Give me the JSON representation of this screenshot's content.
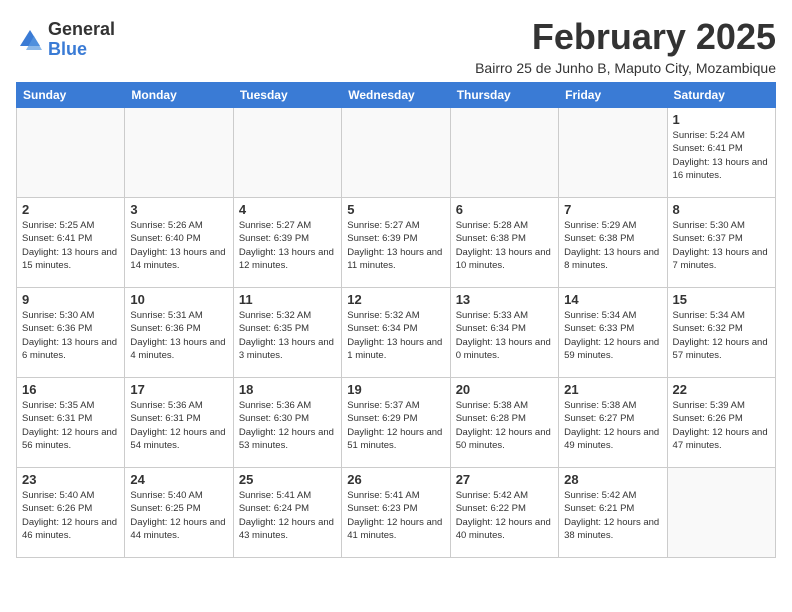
{
  "logo": {
    "general": "General",
    "blue": "Blue"
  },
  "header": {
    "month": "February 2025",
    "location": "Bairro 25 de Junho B, Maputo City, Mozambique"
  },
  "weekdays": [
    "Sunday",
    "Monday",
    "Tuesday",
    "Wednesday",
    "Thursday",
    "Friday",
    "Saturday"
  ],
  "days": {
    "day1": {
      "num": "1",
      "sunrise": "5:24 AM",
      "sunset": "6:41 PM",
      "daylight": "13 hours and 16 minutes."
    },
    "day2": {
      "num": "2",
      "sunrise": "5:25 AM",
      "sunset": "6:41 PM",
      "daylight": "13 hours and 15 minutes."
    },
    "day3": {
      "num": "3",
      "sunrise": "5:26 AM",
      "sunset": "6:40 PM",
      "daylight": "13 hours and 14 minutes."
    },
    "day4": {
      "num": "4",
      "sunrise": "5:27 AM",
      "sunset": "6:39 PM",
      "daylight": "13 hours and 12 minutes."
    },
    "day5": {
      "num": "5",
      "sunrise": "5:27 AM",
      "sunset": "6:39 PM",
      "daylight": "13 hours and 11 minutes."
    },
    "day6": {
      "num": "6",
      "sunrise": "5:28 AM",
      "sunset": "6:38 PM",
      "daylight": "13 hours and 10 minutes."
    },
    "day7": {
      "num": "7",
      "sunrise": "5:29 AM",
      "sunset": "6:38 PM",
      "daylight": "13 hours and 8 minutes."
    },
    "day8": {
      "num": "8",
      "sunrise": "5:30 AM",
      "sunset": "6:37 PM",
      "daylight": "13 hours and 7 minutes."
    },
    "day9": {
      "num": "9",
      "sunrise": "5:30 AM",
      "sunset": "6:36 PM",
      "daylight": "13 hours and 6 minutes."
    },
    "day10": {
      "num": "10",
      "sunrise": "5:31 AM",
      "sunset": "6:36 PM",
      "daylight": "13 hours and 4 minutes."
    },
    "day11": {
      "num": "11",
      "sunrise": "5:32 AM",
      "sunset": "6:35 PM",
      "daylight": "13 hours and 3 minutes."
    },
    "day12": {
      "num": "12",
      "sunrise": "5:32 AM",
      "sunset": "6:34 PM",
      "daylight": "13 hours and 1 minute."
    },
    "day13": {
      "num": "13",
      "sunrise": "5:33 AM",
      "sunset": "6:34 PM",
      "daylight": "13 hours and 0 minutes."
    },
    "day14": {
      "num": "14",
      "sunrise": "5:34 AM",
      "sunset": "6:33 PM",
      "daylight": "12 hours and 59 minutes."
    },
    "day15": {
      "num": "15",
      "sunrise": "5:34 AM",
      "sunset": "6:32 PM",
      "daylight": "12 hours and 57 minutes."
    },
    "day16": {
      "num": "16",
      "sunrise": "5:35 AM",
      "sunset": "6:31 PM",
      "daylight": "12 hours and 56 minutes."
    },
    "day17": {
      "num": "17",
      "sunrise": "5:36 AM",
      "sunset": "6:31 PM",
      "daylight": "12 hours and 54 minutes."
    },
    "day18": {
      "num": "18",
      "sunrise": "5:36 AM",
      "sunset": "6:30 PM",
      "daylight": "12 hours and 53 minutes."
    },
    "day19": {
      "num": "19",
      "sunrise": "5:37 AM",
      "sunset": "6:29 PM",
      "daylight": "12 hours and 51 minutes."
    },
    "day20": {
      "num": "20",
      "sunrise": "5:38 AM",
      "sunset": "6:28 PM",
      "daylight": "12 hours and 50 minutes."
    },
    "day21": {
      "num": "21",
      "sunrise": "5:38 AM",
      "sunset": "6:27 PM",
      "daylight": "12 hours and 49 minutes."
    },
    "day22": {
      "num": "22",
      "sunrise": "5:39 AM",
      "sunset": "6:26 PM",
      "daylight": "12 hours and 47 minutes."
    },
    "day23": {
      "num": "23",
      "sunrise": "5:40 AM",
      "sunset": "6:26 PM",
      "daylight": "12 hours and 46 minutes."
    },
    "day24": {
      "num": "24",
      "sunrise": "5:40 AM",
      "sunset": "6:25 PM",
      "daylight": "12 hours and 44 minutes."
    },
    "day25": {
      "num": "25",
      "sunrise": "5:41 AM",
      "sunset": "6:24 PM",
      "daylight": "12 hours and 43 minutes."
    },
    "day26": {
      "num": "26",
      "sunrise": "5:41 AM",
      "sunset": "6:23 PM",
      "daylight": "12 hours and 41 minutes."
    },
    "day27": {
      "num": "27",
      "sunrise": "5:42 AM",
      "sunset": "6:22 PM",
      "daylight": "12 hours and 40 minutes."
    },
    "day28": {
      "num": "28",
      "sunrise": "5:42 AM",
      "sunset": "6:21 PM",
      "daylight": "12 hours and 38 minutes."
    }
  },
  "labels": {
    "sunrise": "Sunrise:",
    "sunset": "Sunset:",
    "daylight": "Daylight:"
  }
}
